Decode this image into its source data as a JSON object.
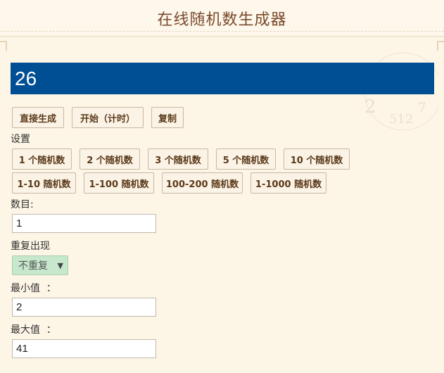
{
  "header": {
    "title": "在线随机数生成器"
  },
  "result": {
    "value": "26"
  },
  "actions": {
    "generate": "直接生成",
    "start_timer": "开始（计时）",
    "copy": "复制"
  },
  "settings": {
    "label": "设置",
    "count_presets": [
      "1 个随机数",
      "2 个随机数",
      "3 个随机数",
      "5 个随机数",
      "10 个随机数"
    ],
    "range_presets": [
      "1-10 随机数",
      "1-100 随机数",
      "100-200 随机数",
      "1-1000 随机数"
    ]
  },
  "count": {
    "label": "数目:",
    "value": "1"
  },
  "repeat": {
    "label": "重复出现",
    "selected": "不重复"
  },
  "min": {
    "label": "最小值  ：",
    "value": "2"
  },
  "max": {
    "label": "最大值  ：",
    "value": "41"
  },
  "colors": {
    "result_bg": "#004f94",
    "page_bg": "#fdf5e6",
    "select_bg": "#c7e8cc",
    "title": "#7a4a2a"
  },
  "icons": {
    "select_arrow": "chevron-down-icon"
  }
}
